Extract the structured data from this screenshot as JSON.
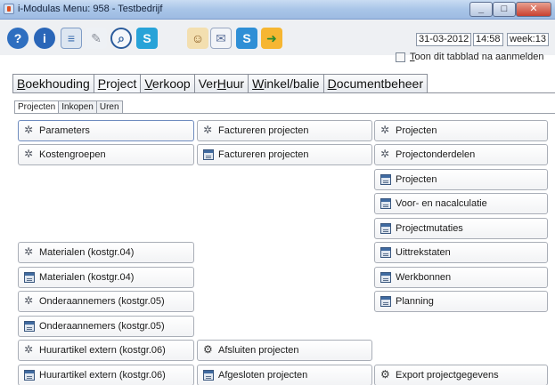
{
  "window": {
    "title": "i-Modulas Menu: 958 - Testbedrijf"
  },
  "toolbar": {
    "icons": [
      "help-icon",
      "info-icon",
      "printer-icon",
      "tools-icon",
      "search-icon",
      "skype-icon",
      "user-icon",
      "mail-icon",
      "skype-square-icon",
      "exit-icon"
    ],
    "date": "31-03-2012",
    "time": "14:58",
    "week": "week:13",
    "show_tab_checkbox_u": "T",
    "show_tab_checkbox_rest": "oon dit tabblad na aanmelden"
  },
  "main_tabs": [
    {
      "u": "B",
      "rest": "oekhouding"
    },
    {
      "u": "P",
      "rest": "roject"
    },
    {
      "u": "V",
      "rest": "erkoop"
    },
    {
      "pre": "Ver",
      "u": "H",
      "rest": "uur"
    },
    {
      "u": "W",
      "rest": "inkel/balie"
    },
    {
      "u": "D",
      "rest": "ocumentbeheer"
    }
  ],
  "sub_tabs": [
    "Projecten",
    "Inkopen",
    "Uren"
  ],
  "buttons": {
    "parameters": "Parameters",
    "kostengroepen": "Kostengroepen",
    "materialen_gear": "Materialen (kostgr.04)",
    "materialen_form": "Materialen (kostgr.04)",
    "onderaannemers_gear": "Onderaannemers (kostgr.05)",
    "onderaannemers_form": "Onderaannemers (kostgr.05)",
    "huur_extern_gear": "Huurartikel extern (kostgr.06)",
    "huur_extern_form": "Huurartikel extern (kostgr.06)",
    "factureren_gear": "Factureren projecten",
    "factureren_form": "Factureren projecten",
    "afsluiten": "Afsluiten projecten",
    "afgesloten": "Afgesloten projecten",
    "projecten_gear": "Projecten",
    "projectonderdelen": "Projectonderdelen",
    "projecten_form": "Projecten",
    "voor_nacalculatie": "Voor- en nacalculatie",
    "projectmutaties": "Projectmutaties",
    "uittrekstaten": "Uittrekstaten",
    "werkbonnen": "Werkbonnen",
    "planning": "Planning",
    "export": "Export projectgegevens"
  }
}
